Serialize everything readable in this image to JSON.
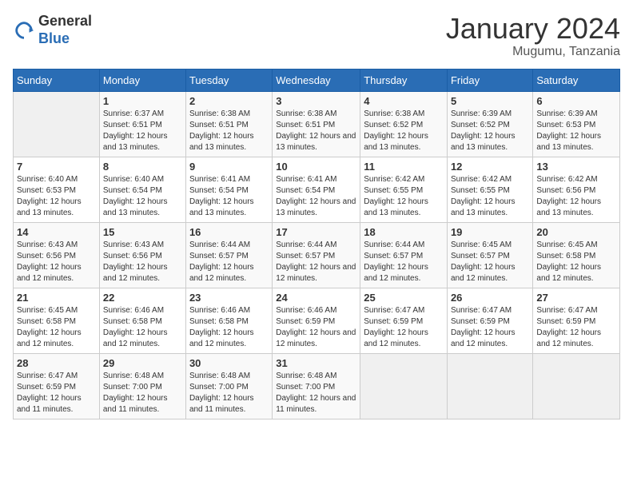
{
  "header": {
    "logo_general": "General",
    "logo_blue": "Blue",
    "month_title": "January 2024",
    "location": "Mugumu, Tanzania"
  },
  "weekdays": [
    "Sunday",
    "Monday",
    "Tuesday",
    "Wednesday",
    "Thursday",
    "Friday",
    "Saturday"
  ],
  "weeks": [
    [
      {
        "day": "",
        "sunrise": "",
        "sunset": "",
        "daylight": "",
        "empty": true
      },
      {
        "day": "1",
        "sunrise": "Sunrise: 6:37 AM",
        "sunset": "Sunset: 6:51 PM",
        "daylight": "Daylight: 12 hours and 13 minutes."
      },
      {
        "day": "2",
        "sunrise": "Sunrise: 6:38 AM",
        "sunset": "Sunset: 6:51 PM",
        "daylight": "Daylight: 12 hours and 13 minutes."
      },
      {
        "day": "3",
        "sunrise": "Sunrise: 6:38 AM",
        "sunset": "Sunset: 6:51 PM",
        "daylight": "Daylight: 12 hours and 13 minutes."
      },
      {
        "day": "4",
        "sunrise": "Sunrise: 6:38 AM",
        "sunset": "Sunset: 6:52 PM",
        "daylight": "Daylight: 12 hours and 13 minutes."
      },
      {
        "day": "5",
        "sunrise": "Sunrise: 6:39 AM",
        "sunset": "Sunset: 6:52 PM",
        "daylight": "Daylight: 12 hours and 13 minutes."
      },
      {
        "day": "6",
        "sunrise": "Sunrise: 6:39 AM",
        "sunset": "Sunset: 6:53 PM",
        "daylight": "Daylight: 12 hours and 13 minutes."
      }
    ],
    [
      {
        "day": "7",
        "sunrise": "Sunrise: 6:40 AM",
        "sunset": "Sunset: 6:53 PM",
        "daylight": "Daylight: 12 hours and 13 minutes."
      },
      {
        "day": "8",
        "sunrise": "Sunrise: 6:40 AM",
        "sunset": "Sunset: 6:54 PM",
        "daylight": "Daylight: 12 hours and 13 minutes."
      },
      {
        "day": "9",
        "sunrise": "Sunrise: 6:41 AM",
        "sunset": "Sunset: 6:54 PM",
        "daylight": "Daylight: 12 hours and 13 minutes."
      },
      {
        "day": "10",
        "sunrise": "Sunrise: 6:41 AM",
        "sunset": "Sunset: 6:54 PM",
        "daylight": "Daylight: 12 hours and 13 minutes."
      },
      {
        "day": "11",
        "sunrise": "Sunrise: 6:42 AM",
        "sunset": "Sunset: 6:55 PM",
        "daylight": "Daylight: 12 hours and 13 minutes."
      },
      {
        "day": "12",
        "sunrise": "Sunrise: 6:42 AM",
        "sunset": "Sunset: 6:55 PM",
        "daylight": "Daylight: 12 hours and 13 minutes."
      },
      {
        "day": "13",
        "sunrise": "Sunrise: 6:42 AM",
        "sunset": "Sunset: 6:56 PM",
        "daylight": "Daylight: 12 hours and 13 minutes."
      }
    ],
    [
      {
        "day": "14",
        "sunrise": "Sunrise: 6:43 AM",
        "sunset": "Sunset: 6:56 PM",
        "daylight": "Daylight: 12 hours and 12 minutes."
      },
      {
        "day": "15",
        "sunrise": "Sunrise: 6:43 AM",
        "sunset": "Sunset: 6:56 PM",
        "daylight": "Daylight: 12 hours and 12 minutes."
      },
      {
        "day": "16",
        "sunrise": "Sunrise: 6:44 AM",
        "sunset": "Sunset: 6:57 PM",
        "daylight": "Daylight: 12 hours and 12 minutes."
      },
      {
        "day": "17",
        "sunrise": "Sunrise: 6:44 AM",
        "sunset": "Sunset: 6:57 PM",
        "daylight": "Daylight: 12 hours and 12 minutes."
      },
      {
        "day": "18",
        "sunrise": "Sunrise: 6:44 AM",
        "sunset": "Sunset: 6:57 PM",
        "daylight": "Daylight: 12 hours and 12 minutes."
      },
      {
        "day": "19",
        "sunrise": "Sunrise: 6:45 AM",
        "sunset": "Sunset: 6:57 PM",
        "daylight": "Daylight: 12 hours and 12 minutes."
      },
      {
        "day": "20",
        "sunrise": "Sunrise: 6:45 AM",
        "sunset": "Sunset: 6:58 PM",
        "daylight": "Daylight: 12 hours and 12 minutes."
      }
    ],
    [
      {
        "day": "21",
        "sunrise": "Sunrise: 6:45 AM",
        "sunset": "Sunset: 6:58 PM",
        "daylight": "Daylight: 12 hours and 12 minutes."
      },
      {
        "day": "22",
        "sunrise": "Sunrise: 6:46 AM",
        "sunset": "Sunset: 6:58 PM",
        "daylight": "Daylight: 12 hours and 12 minutes."
      },
      {
        "day": "23",
        "sunrise": "Sunrise: 6:46 AM",
        "sunset": "Sunset: 6:58 PM",
        "daylight": "Daylight: 12 hours and 12 minutes."
      },
      {
        "day": "24",
        "sunrise": "Sunrise: 6:46 AM",
        "sunset": "Sunset: 6:59 PM",
        "daylight": "Daylight: 12 hours and 12 minutes."
      },
      {
        "day": "25",
        "sunrise": "Sunrise: 6:47 AM",
        "sunset": "Sunset: 6:59 PM",
        "daylight": "Daylight: 12 hours and 12 minutes."
      },
      {
        "day": "26",
        "sunrise": "Sunrise: 6:47 AM",
        "sunset": "Sunset: 6:59 PM",
        "daylight": "Daylight: 12 hours and 12 minutes."
      },
      {
        "day": "27",
        "sunrise": "Sunrise: 6:47 AM",
        "sunset": "Sunset: 6:59 PM",
        "daylight": "Daylight: 12 hours and 12 minutes."
      }
    ],
    [
      {
        "day": "28",
        "sunrise": "Sunrise: 6:47 AM",
        "sunset": "Sunset: 6:59 PM",
        "daylight": "Daylight: 12 hours and 11 minutes."
      },
      {
        "day": "29",
        "sunrise": "Sunrise: 6:48 AM",
        "sunset": "Sunset: 7:00 PM",
        "daylight": "Daylight: 12 hours and 11 minutes."
      },
      {
        "day": "30",
        "sunrise": "Sunrise: 6:48 AM",
        "sunset": "Sunset: 7:00 PM",
        "daylight": "Daylight: 12 hours and 11 minutes."
      },
      {
        "day": "31",
        "sunrise": "Sunrise: 6:48 AM",
        "sunset": "Sunset: 7:00 PM",
        "daylight": "Daylight: 12 hours and 11 minutes."
      },
      {
        "day": "",
        "sunrise": "",
        "sunset": "",
        "daylight": "",
        "empty": true
      },
      {
        "day": "",
        "sunrise": "",
        "sunset": "",
        "daylight": "",
        "empty": true
      },
      {
        "day": "",
        "sunrise": "",
        "sunset": "",
        "daylight": "",
        "empty": true
      }
    ]
  ]
}
